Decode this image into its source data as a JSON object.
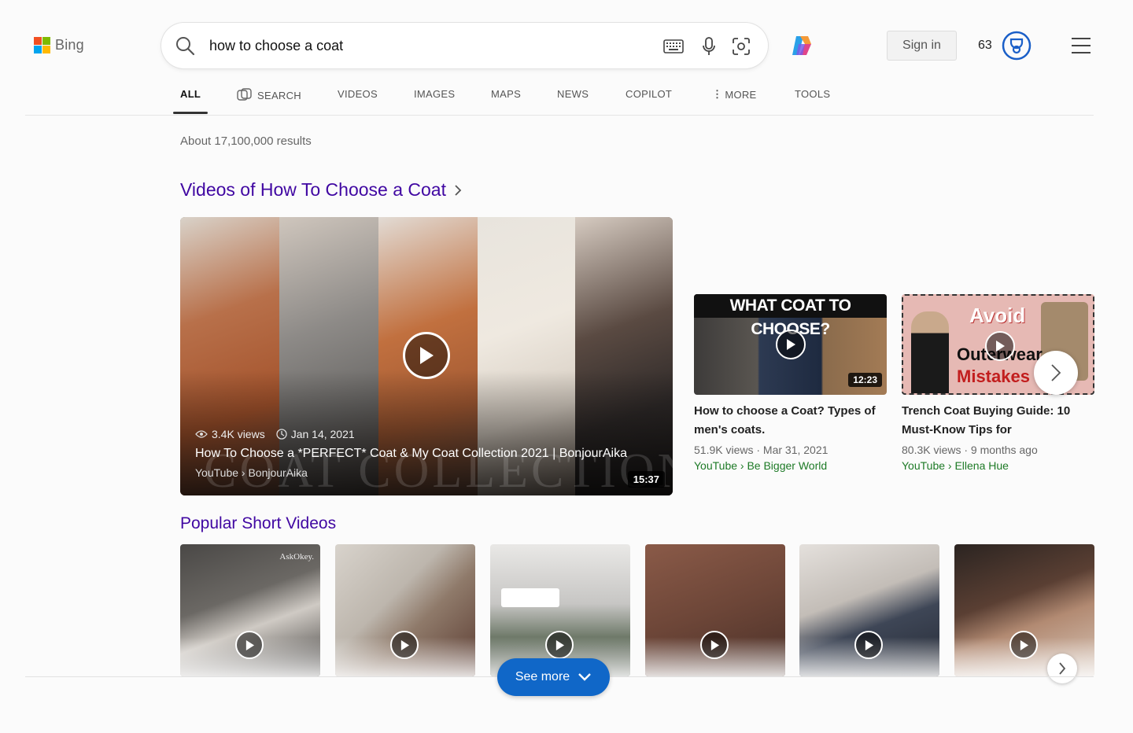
{
  "header": {
    "logo_text": "Bing",
    "search_query": "how to choose a coat",
    "signin_label": "Sign in",
    "reward_points": "63"
  },
  "tabs": [
    {
      "label": "ALL",
      "active": true
    },
    {
      "label": "SEARCH"
    },
    {
      "label": "VIDEOS"
    },
    {
      "label": "IMAGES"
    },
    {
      "label": "MAPS"
    },
    {
      "label": "NEWS"
    },
    {
      "label": "COPILOT"
    },
    {
      "label": "MORE"
    },
    {
      "label": "TOOLS"
    }
  ],
  "results_count": "About 17,100,000 results",
  "videos_section": {
    "title": "Videos of How To Choose a Coat",
    "main": {
      "views": "3.4K views",
      "date": "Jan 14, 2021",
      "title": "How To Choose a *PERFECT* Coat & My Coat Collection 2021 | BonjourAika",
      "source": "YouTube › BonjourAika",
      "duration": "15:37",
      "overlay_text": "COAT COLLECTION"
    },
    "side": [
      {
        "thumb_text": "WHAT COAT TO CHOOSE?",
        "duration": "12:23",
        "title": "How to choose a Coat? Types of men's coats.",
        "meta": "51.9K views · Mar 31, 2021",
        "source": "YouTube › Be Bigger World"
      },
      {
        "thumb_text_1": "Avoid",
        "thumb_text_2": "Outerwear",
        "thumb_text_3": "Mistakes",
        "title": "Trench Coat Buying Guide: 10 Must-Know Tips for",
        "meta": "80.3K views · 9 months ago",
        "source": "YouTube › Ellena Hue"
      }
    ]
  },
  "shorts_section": {
    "title": "Popular Short Videos",
    "short1_watermark": "AskOkey.",
    "see_more_label": "See more"
  },
  "colors": {
    "accent_link": "#4007a2",
    "source_green": "#1d7a26",
    "see_more_blue": "#1067c8"
  }
}
